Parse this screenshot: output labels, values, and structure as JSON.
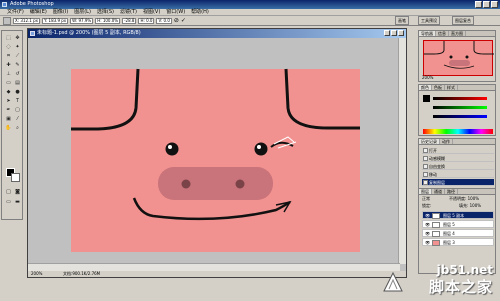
{
  "window": {
    "title": "Adobe Photoshop"
  },
  "menu": [
    "文件(F)",
    "编辑(E)",
    "图像(I)",
    "图层(L)",
    "选择(S)",
    "滤镜(T)",
    "视图(V)",
    "窗口(W)",
    "帮助(H)"
  ],
  "options": {
    "x": "X: 312.1 px",
    "y": "Y: 183.9 px",
    "w": "W: 97.9%",
    "h": "H: 100.0%",
    "angle": "-28.8",
    "hskew": "H: 0.0",
    "vskew": "V: 0.0",
    "tabs": [
      "画笔",
      "工具预设",
      "图层复合"
    ]
  },
  "document": {
    "title": "未标题-1.psd @ 200% (图层 5 副本, RGB/8)",
    "zoom": "200%",
    "size": "文档:900.1K/2.76M"
  },
  "navigator": {
    "tabs": [
      "导航器",
      "信息",
      "直方图"
    ],
    "zoom": "200%"
  },
  "color_panel": {
    "tabs": [
      "颜色",
      "色板",
      "样式"
    ]
  },
  "history": {
    "tabs": [
      "历史记录",
      "动作"
    ],
    "items": [
      "打开",
      "动感模糊",
      "自由变换",
      "移动",
      "复制图层"
    ]
  },
  "layers": {
    "tabs": [
      "图层",
      "通道",
      "路径"
    ],
    "mode": "正常",
    "opacity_label": "不透明度: 100%",
    "lock_label": "锁定:",
    "fill_label": "填充: 100%",
    "items": [
      "图层 5 副本",
      "图层 5",
      "图层 4",
      "图层 3"
    ]
  },
  "watermark": {
    "url": "jb51.net",
    "brand": "脚本之家"
  },
  "colors": {
    "canvas_pink": "#f19290",
    "nose": "#c9737a",
    "title_blue": "#0a246a",
    "chrome": "#d4d0c8"
  }
}
